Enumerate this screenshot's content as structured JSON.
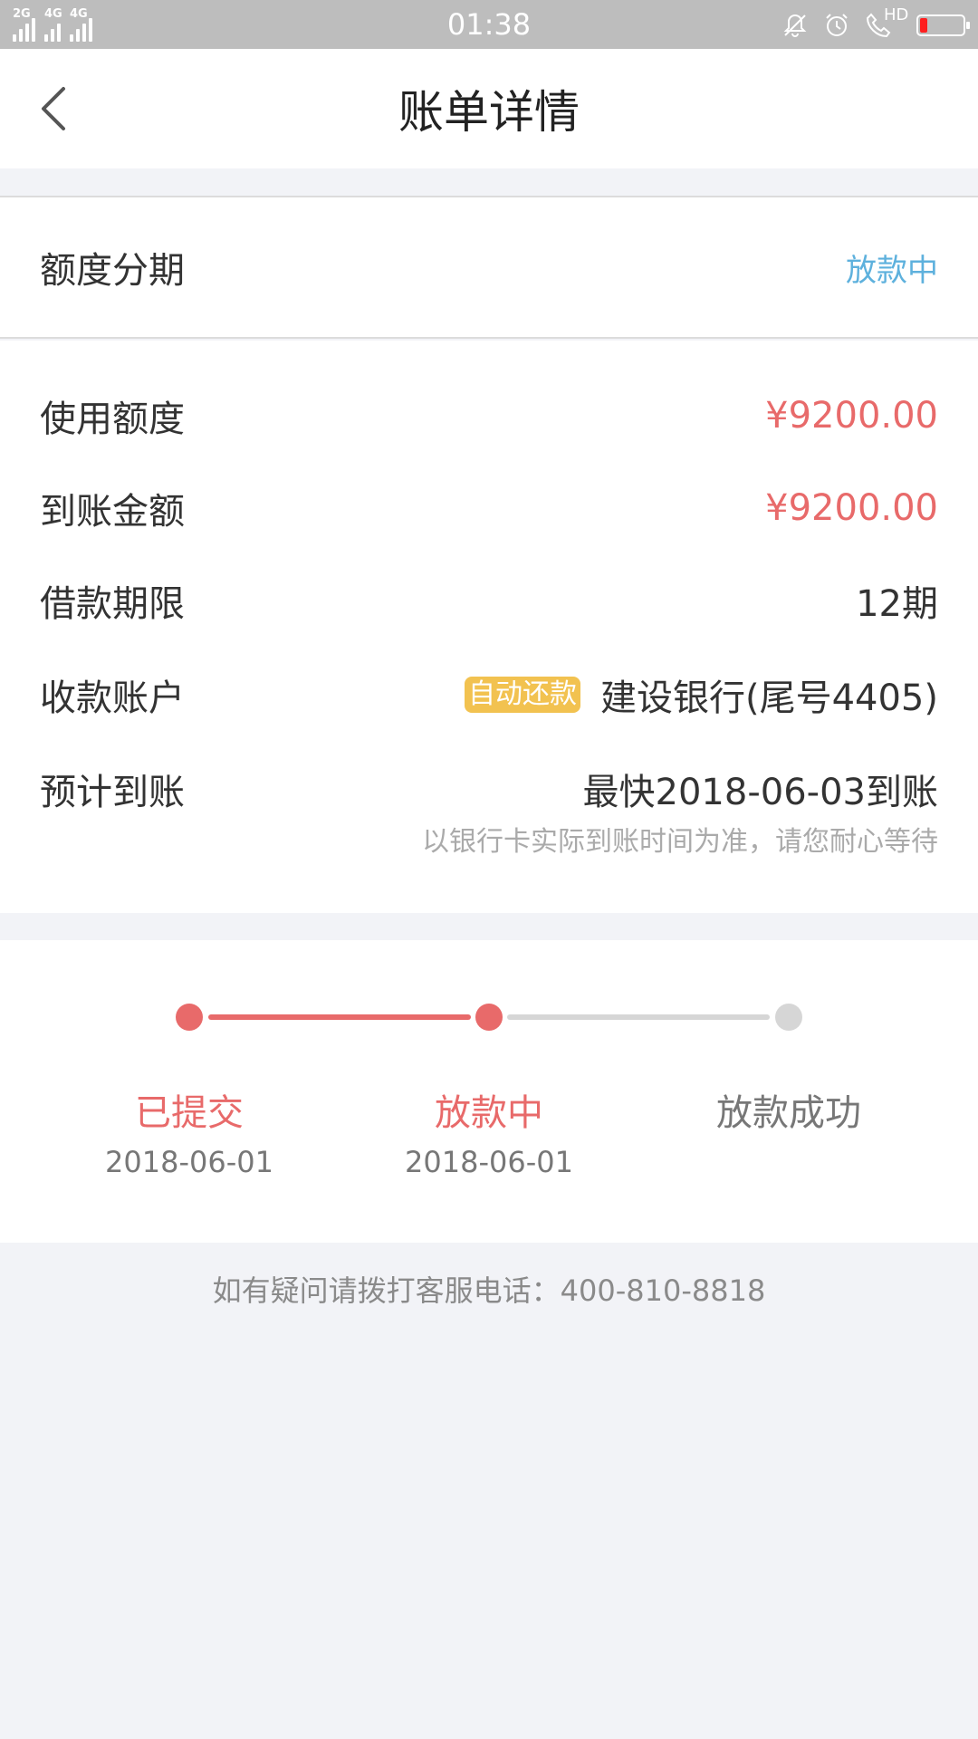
{
  "status_bar": {
    "sim1": "2G",
    "sim2": "4G",
    "sim3": "4G",
    "time": "01:38",
    "call_tag": "HD",
    "battery_level": 0.18,
    "battery_color": "#ff1e1e",
    "icons": [
      "bell-off-icon",
      "alarm-icon",
      "hd-call-icon",
      "battery-icon"
    ]
  },
  "nav": {
    "title": "账单详情"
  },
  "summary": {
    "type_label": "额度分期",
    "status": "放款中"
  },
  "details": {
    "rows": [
      {
        "label": "使用额度",
        "value": "¥9200.00"
      },
      {
        "label": "到账金额",
        "value": "¥9200.00"
      },
      {
        "label": "借款期限",
        "value": "12期"
      },
      {
        "label": "收款账户",
        "badge": "自动还款",
        "value": "建设银行(尾号4405)"
      },
      {
        "label": "预计到账",
        "value": "最快2018-06-03到账"
      }
    ],
    "note": "以银行卡实际到账时间为准，请您耐心等待"
  },
  "progress": {
    "steps": [
      {
        "name": "已提交",
        "date": "2018-06-01",
        "done": true
      },
      {
        "name": "放款中",
        "date": "2018-06-01",
        "done": true
      },
      {
        "name": "放款成功",
        "date": "",
        "done": false
      }
    ]
  },
  "footer": {
    "hotline": "如有疑问请拨打客服电话：400-810-8818"
  },
  "colors": {
    "accent": "#e86a6a",
    "status_blue": "#5eb1dd",
    "badge": "#f2c250",
    "inactive": "#d6d6d6"
  }
}
